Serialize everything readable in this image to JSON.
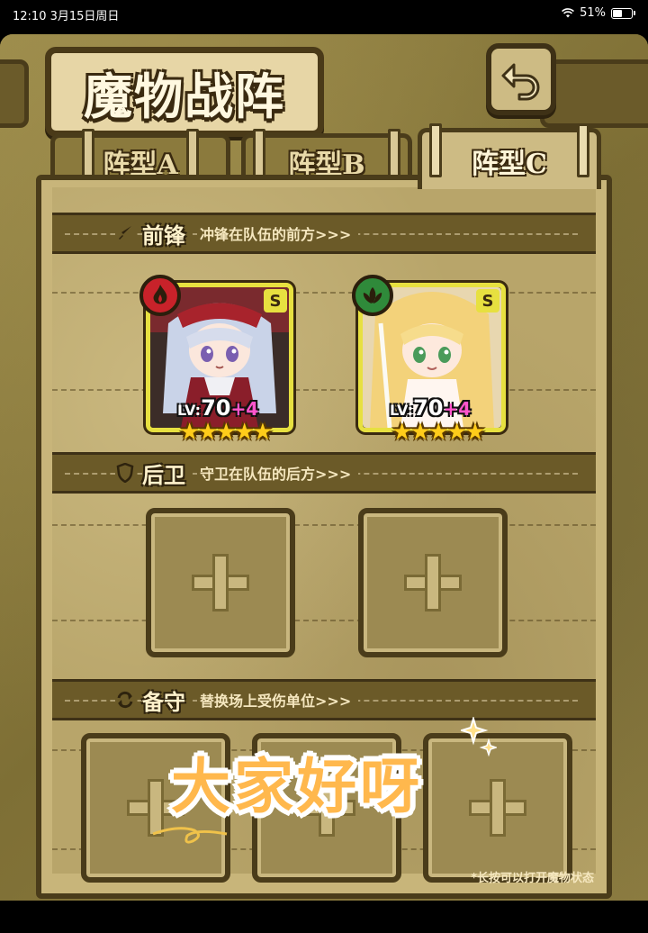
{
  "status_bar": {
    "time": "12:10",
    "date": "3月15日周日",
    "battery": "51%",
    "battery_level": 0.51
  },
  "header": {
    "title": "魔物战阵",
    "back_icon": "back-arrow-icon"
  },
  "tabs": [
    {
      "label": "阵型A",
      "selected": false
    },
    {
      "label": "阵型B",
      "selected": false
    },
    {
      "label": "阵型C",
      "selected": true
    }
  ],
  "sections": {
    "front": {
      "title": "前锋",
      "desc": "冲锋在队伍的前方>>>",
      "icon": "sword-icon"
    },
    "back": {
      "title": "后卫",
      "desc": "守卫在队伍的后方>>>",
      "icon": "shield-icon"
    },
    "reserve": {
      "title": "备守",
      "desc": "替换场上受伤单位>>>",
      "icon": "refresh-icon"
    }
  },
  "heroes": [
    {
      "rank": "S",
      "level_label": "LV:",
      "level": "70",
      "bonus": "+4",
      "stars": 5,
      "element": "fire",
      "element_color": "#c8222a"
    },
    {
      "rank": "S",
      "level_label": "LV:",
      "level": "70",
      "bonus": "+4",
      "stars": 5,
      "element": "nature",
      "element_color": "#2f8a3a"
    }
  ],
  "sticker_text": "大家好呀",
  "hint": "*长按可以打开魔物状态",
  "colors": {
    "accent": "#e7e040",
    "panel": "#b8a56a",
    "frame": "#4a3c1a"
  }
}
